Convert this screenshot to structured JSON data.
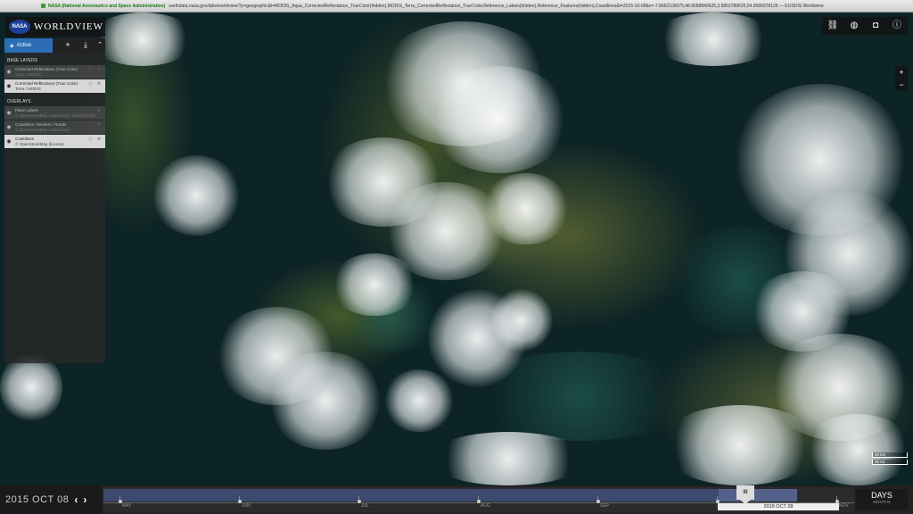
{
  "browser": {
    "site_badge": "NASA (National Aeronautics and Space Administration)",
    "url": "earthdata.nasa.gov/labs/worldview/?p=geographic&l=MODIS_Aqua_CorrectedReflectance_TrueColor(hidden),MODIS_Terra_CorrectedReflectance_TrueColor,Reference_Labels(hidden),Reference_Features(hidden),Coastlines&t=2015-10-08&v=-7.8662109375,48.8058840625,3.5853789625,54.9580078125 — EOSDIS Worldview"
  },
  "logo": {
    "nasa": "NASA",
    "title": "WORLDVIEW"
  },
  "panel": {
    "tab_active": "Active",
    "base_layers_heading": "BASE LAYERS",
    "overlays_heading": "OVERLAYS",
    "base_layers": [
      {
        "name": "Corrected Reflectance (True Color)",
        "source": "Aqua / MODIS",
        "visible": false
      },
      {
        "name": "Corrected Reflectance (True Color)",
        "source": "Terra / MODIS",
        "visible": true
      }
    ],
    "overlays": [
      {
        "name": "Place Labels",
        "source": "© OpenStreetMap contributors, Natural Earth",
        "visible": false
      },
      {
        "name": "Coastlines / Borders / Roads",
        "source": "© OpenStreetMap contributors",
        "visible": false
      },
      {
        "name": "Coastlines",
        "source": "© OpenStreetMap (license)",
        "visible": true
      }
    ]
  },
  "map_tools": {
    "icons": [
      "link-icon",
      "globe-icon",
      "camera-icon",
      "info-icon"
    ],
    "zoom_in": "+",
    "zoom_out": "−"
  },
  "scale": {
    "km": "20 km",
    "mi": "20 mi"
  },
  "timeline": {
    "date_label": "2015 OCT 08",
    "prev": "‹",
    "next": "›",
    "months": [
      "MAY",
      "JUN",
      "JUL",
      "AUG",
      "SEP",
      "OCT",
      "NOV"
    ],
    "handle": "III",
    "selected_label": "2015 OCT 28",
    "zoom_level": "DAYS",
    "zoom_sub": "MONTHS"
  }
}
